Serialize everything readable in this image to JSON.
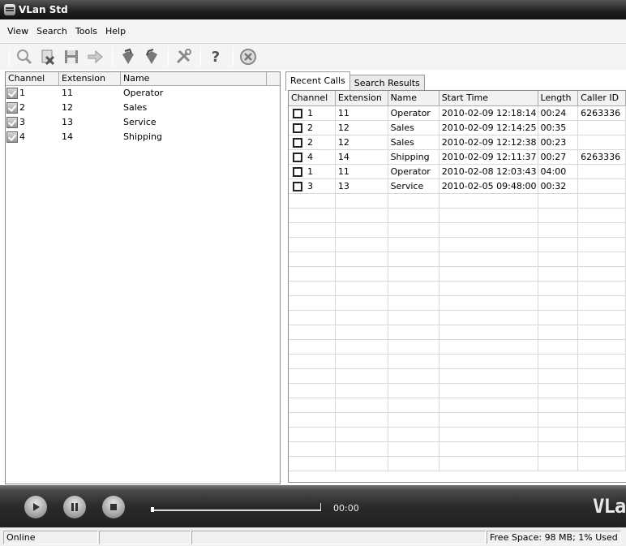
{
  "window": {
    "title": "VLan Std"
  },
  "menu": [
    "View",
    "Search",
    "Tools",
    "Help"
  ],
  "toolbar": {
    "help_glyph": "?"
  },
  "left": {
    "columns": [
      "Channel",
      "Extension",
      "Name"
    ],
    "rows": [
      {
        "channel": "1",
        "extension": "11",
        "name": "Operator"
      },
      {
        "channel": "2",
        "extension": "12",
        "name": "Sales"
      },
      {
        "channel": "3",
        "extension": "13",
        "name": "Service"
      },
      {
        "channel": "4",
        "extension": "14",
        "name": "Shipping"
      }
    ]
  },
  "tabs": [
    "Recent Calls",
    "Search Results"
  ],
  "calls": {
    "columns": [
      "Channel",
      "Extension",
      "Name",
      "Start Time",
      "Length",
      "Caller ID"
    ],
    "rows": [
      [
        "1",
        "11",
        "Operator",
        "2010-02-09 12:18:14",
        "00:24",
        "6263336"
      ],
      [
        "2",
        "12",
        "Sales",
        "2010-02-09 12:14:25",
        "00:35",
        ""
      ],
      [
        "2",
        "12",
        "Sales",
        "2010-02-09 12:12:38",
        "00:23",
        ""
      ],
      [
        "4",
        "14",
        "Shipping",
        "2010-02-09 12:11:37",
        "00:27",
        "6263336"
      ],
      [
        "1",
        "11",
        "Operator",
        "2010-02-08 12:03:43",
        "04:00",
        ""
      ],
      [
        "3",
        "13",
        "Service",
        "2010-02-05 09:48:00",
        "00:32",
        ""
      ]
    ]
  },
  "player": {
    "time": "00:00",
    "logo": "VLa",
    "progress": 0
  },
  "status": {
    "state": "Online",
    "free_space": "Free Space: 98 MB;  1% Used"
  }
}
